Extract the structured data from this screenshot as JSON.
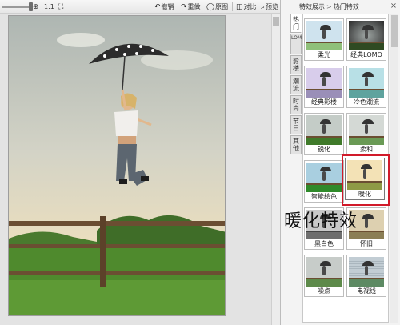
{
  "toolbar": {
    "zoom_ratio_label": "1:1",
    "undo_label": "撤销",
    "redo_label": "重做",
    "original_label": "原图",
    "compare_label": "对比",
    "preview_label": "预览"
  },
  "panel": {
    "breadcrumb": [
      "特效展示",
      "热门特效"
    ],
    "category_tabs": [
      "热门",
      "LOMO",
      "影楼",
      "潮流",
      "时尚",
      "节日",
      "其他"
    ],
    "effects": [
      {
        "label": "柔光",
        "tint": "#cfe3ee"
      },
      {
        "label": "经典LOMO",
        "tint": "#3b3b3b"
      },
      {
        "label": "经典影楼",
        "tint": "#c8b8e2"
      },
      {
        "label": "冷色潮流",
        "tint": "#9fd0d9"
      },
      {
        "label": "锐化",
        "tint": "#bcc7c2"
      },
      {
        "label": "柔和",
        "tint": "#cbd3cf"
      },
      {
        "label": "智能绘色",
        "tint": "#9fc5d6"
      },
      {
        "label": "暖化",
        "tint": "#f0dcae"
      },
      {
        "label": "黑白色",
        "tint": "#a9a9a9"
      },
      {
        "label": "怀旧",
        "tint": "#cdbb98"
      },
      {
        "label": "噪点",
        "tint": "#b8c2bd"
      },
      {
        "label": "电视线",
        "tint": "#aebdc6"
      }
    ],
    "selected_effect": "暖化",
    "annotation_text": "暖化特效"
  },
  "colors": {
    "highlight": "#d11a2a",
    "grass": "#4f8a2d",
    "sky": "#cdd0c6"
  }
}
